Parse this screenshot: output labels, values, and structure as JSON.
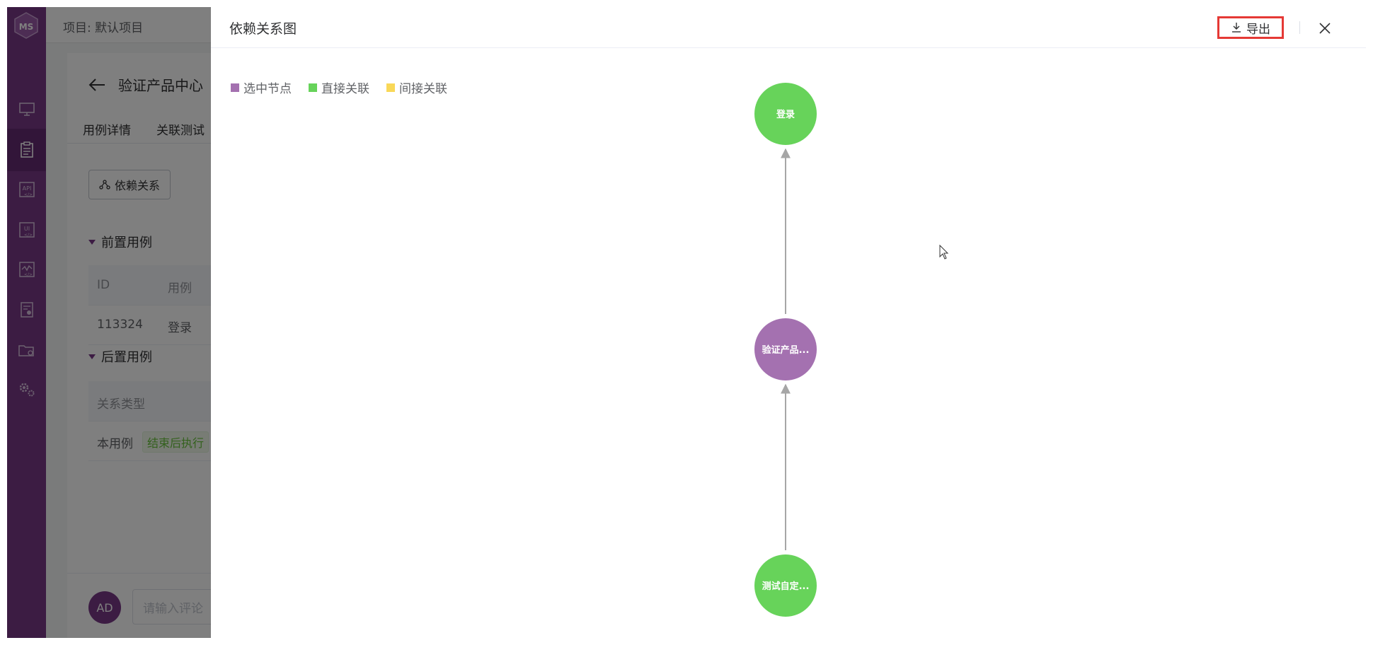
{
  "app": {
    "project_label": "项目: 默认项目"
  },
  "nav": {
    "items": [
      "monitor",
      "case",
      "api",
      "ui",
      "performance",
      "report",
      "project",
      "settings"
    ]
  },
  "case_page": {
    "title": "验证产品中心",
    "tabs": [
      "用例详情",
      "关联测试"
    ],
    "dependency_button": "依赖关系",
    "pre_section": "前置用例",
    "pre_table": {
      "headers": [
        "ID",
        "用例"
      ],
      "rows": [
        [
          "113324",
          "登录"
        ]
      ]
    },
    "post_section": "后置用例",
    "post_table": {
      "headers": [
        "关系类型"
      ],
      "rows": [
        [
          "本用例",
          "结束后执行"
        ]
      ]
    },
    "avatar": "AD",
    "comment_placeholder": "请输入评论"
  },
  "drawer": {
    "title": "依赖关系图",
    "export_label": "导出",
    "legend": [
      {
        "label": "选中节点",
        "color": "#a471b0"
      },
      {
        "label": "直接关联",
        "color": "#67d35a"
      },
      {
        "label": "间接关联",
        "color": "#f9d858"
      }
    ]
  },
  "graph": {
    "nodes": [
      {
        "id": "n1",
        "label": "登录",
        "type": "direct"
      },
      {
        "id": "n2",
        "label": "验证产品...",
        "type": "selected"
      },
      {
        "id": "n3",
        "label": "测试自定...",
        "type": "direct"
      }
    ],
    "edges": [
      {
        "from": "n2",
        "to": "n1"
      },
      {
        "from": "n3",
        "to": "n2"
      }
    ]
  }
}
